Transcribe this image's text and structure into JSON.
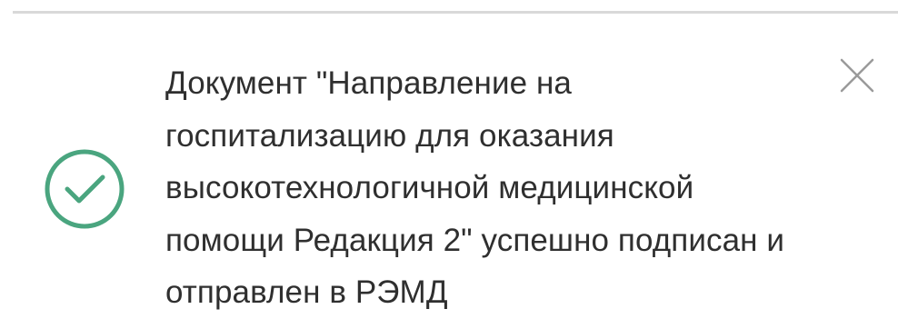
{
  "notification": {
    "type": "success",
    "message": "Документ \"Направление на госпитализацию для оказания высокотехнологичной медицинской помощи Редакция 2\" успешно подписан и отправлен в РЭМД",
    "status_icon": "check-circle-icon",
    "close_icon": "close-icon",
    "colors": {
      "success": "#4aa57f",
      "text": "#2f2f2f",
      "close": "#9a9a9a",
      "divider": "#d9d9d9"
    }
  }
}
